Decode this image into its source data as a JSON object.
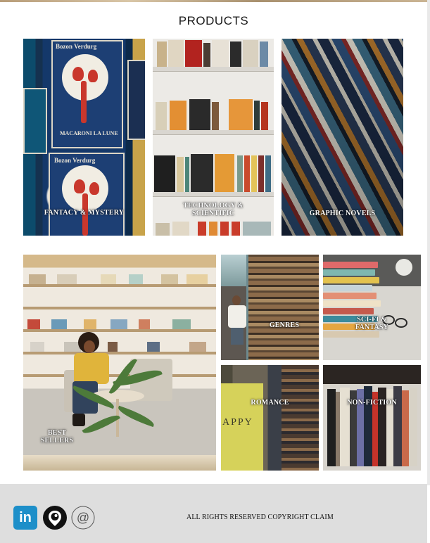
{
  "page": {
    "title": "PRODUCTS"
  },
  "products": {
    "fantasy": "FANTACY & MYSTERY",
    "technology_line1": "TECHNOLOGY &",
    "technology_line2": "SCIENTIFIC",
    "graphic_novels": "GRAPHIC NOVELS",
    "best_sellers_line1": "BEST",
    "best_sellers_line2": "SELLERS",
    "genres": "GENRES",
    "scifi_line1": "SCI-FI &",
    "scifi_line2": "FANTASY",
    "romance": "ROMANCE",
    "non_fiction": "NON-FICTION"
  },
  "image_text": {
    "poster_title_1": "Bozon Verdurg",
    "poster_caption": "MACARONI LA LUNE",
    "poster_title_2": "Bozon Verdurg",
    "book_cover_text": "APPY"
  },
  "footer": {
    "copyright": "ALL RIGHTS RESERVED COPYRIGHT CLAIM",
    "icons": [
      "linkedin-icon",
      "periscope-icon",
      "at-sign-icon"
    ]
  },
  "colors": {
    "footer_bg": "#dedede",
    "linkedin": "#1d8fc9"
  }
}
